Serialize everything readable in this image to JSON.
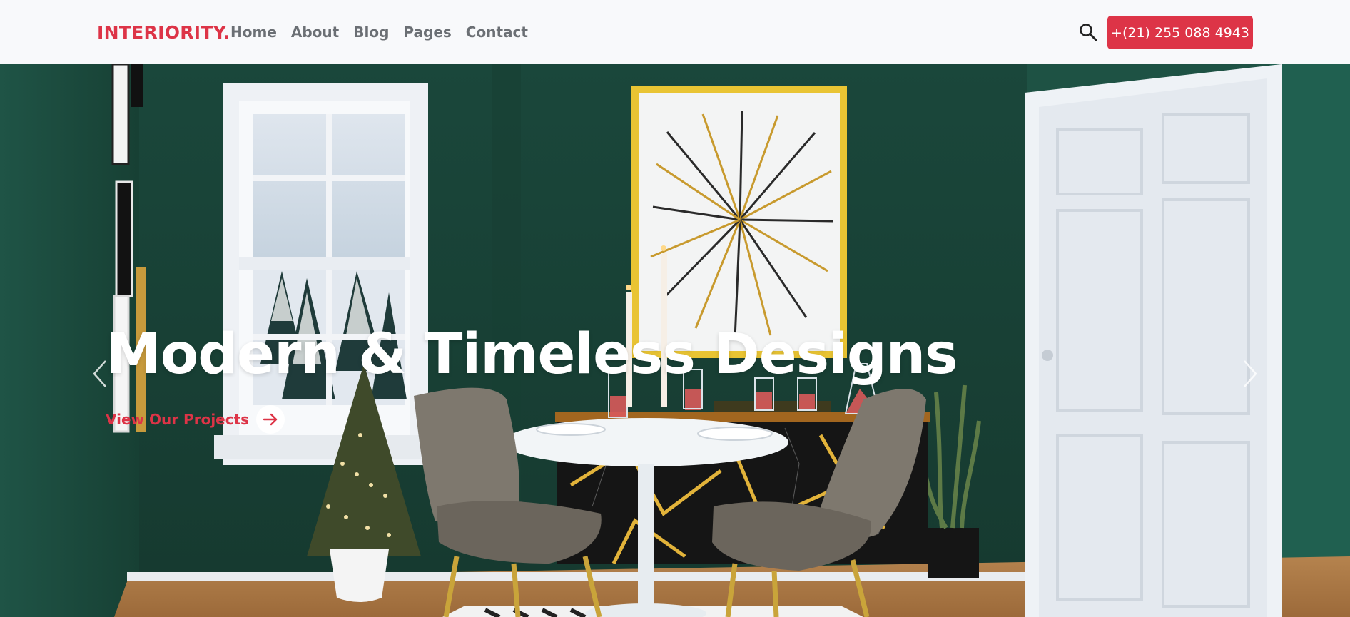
{
  "brand": {
    "name": "INTERIORITY."
  },
  "nav": {
    "items": [
      {
        "label": "Home"
      },
      {
        "label": "About"
      },
      {
        "label": "Blog"
      },
      {
        "label": "Pages"
      },
      {
        "label": "Contact"
      }
    ]
  },
  "header": {
    "search_icon": "search-icon",
    "phone_label": "+(21) 255 088 4943"
  },
  "hero": {
    "title": "Modern & Timeless Designs",
    "cta_label": "View Our Projects",
    "cta_icon": "arrow-right-icon",
    "prev_icon": "chevron-left-icon",
    "next_icon": "chevron-right-icon"
  },
  "colors": {
    "accent": "#dd3447",
    "nav_text": "#6b6f74",
    "header_bg": "#f8f9fb",
    "wall_green": "#1d4a3d"
  }
}
